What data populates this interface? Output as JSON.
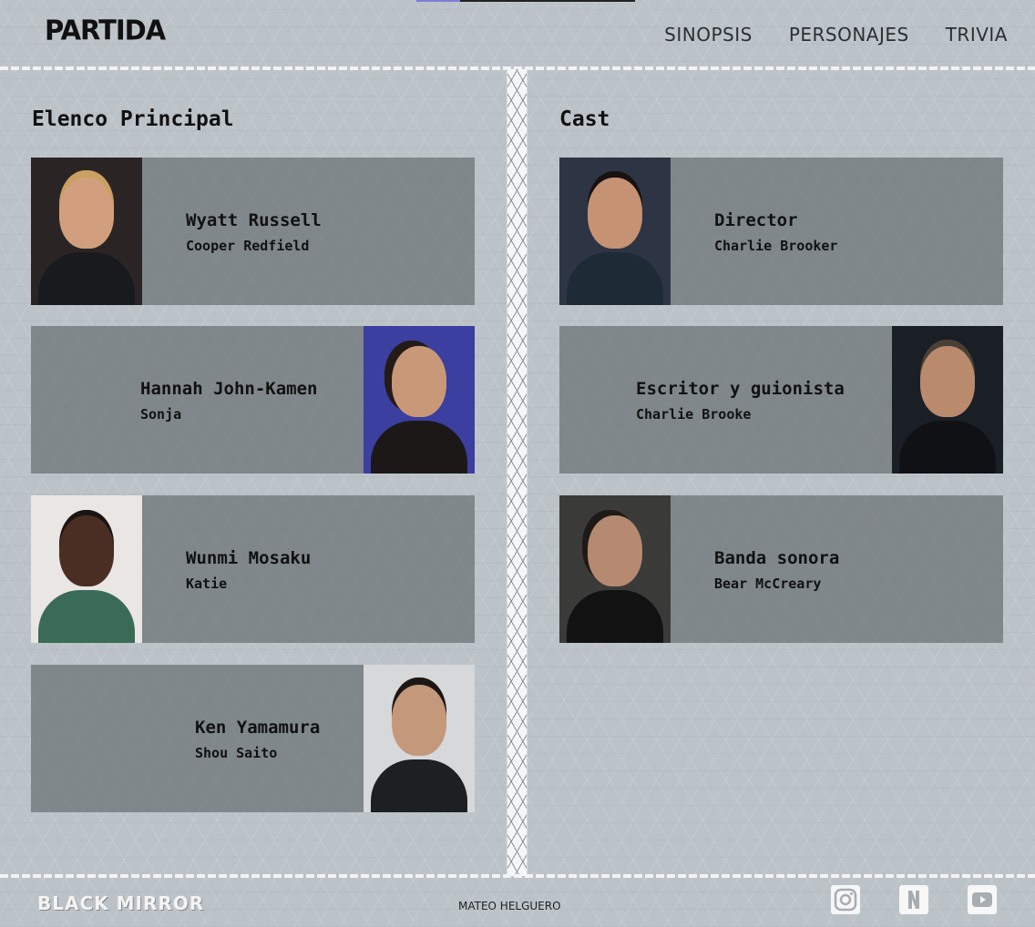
{
  "header": {
    "logo": "PARTIDA",
    "nav": [
      "SINOPSIS",
      "PERSONAJES",
      "TRIVIA"
    ]
  },
  "main_cast": {
    "title": "Elenco Principal",
    "cards": [
      {
        "name": "Wyatt Russell",
        "role": "Cooper Redfield"
      },
      {
        "name": "Hannah John-Kamen",
        "role": "Sonja"
      },
      {
        "name": "Wunmi Mosaku",
        "role": "Katie"
      },
      {
        "name": "Ken Yamamura",
        "role": "Shou Saito"
      }
    ]
  },
  "crew": {
    "title": "Cast",
    "cards": [
      {
        "name": "Director",
        "role": "Charlie Brooker"
      },
      {
        "name": "Escritor y guionista",
        "role": "Charlie Brooke"
      },
      {
        "name": "Banda sonora",
        "role": "Bear McCreary"
      }
    ]
  },
  "footer": {
    "logo": "BLACK MIRROR",
    "credit": "MATEO HELGUERO",
    "social_icons": [
      "instagram-icon",
      "netflix-icon",
      "youtube-icon"
    ]
  },
  "colors": {
    "background": "#bcc3c8",
    "card": "#767d80",
    "text": "#111111"
  }
}
